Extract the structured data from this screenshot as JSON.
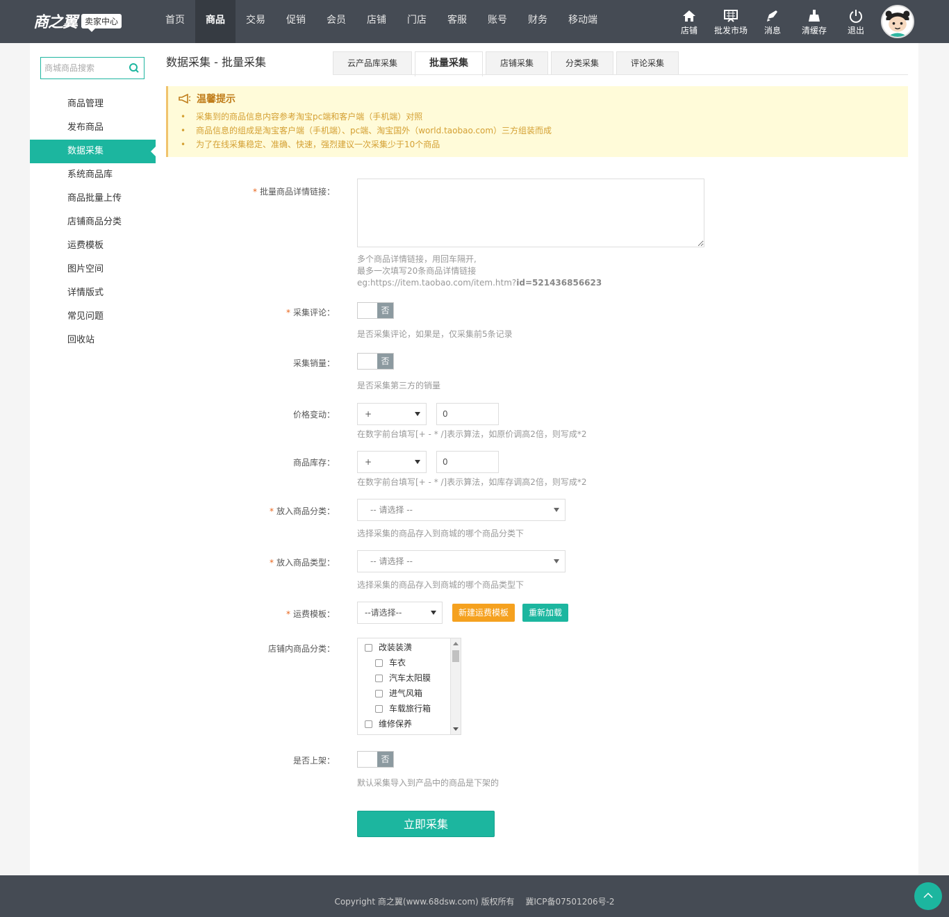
{
  "header": {
    "logo_text": "商之翼",
    "logo_badge": "卖家中心",
    "nav": [
      "首页",
      "商品",
      "交易",
      "促销",
      "会员",
      "店铺",
      "门店",
      "客服",
      "账号",
      "财务",
      "移动端"
    ],
    "active_nav": "商品",
    "tools": [
      {
        "label": "店铺",
        "icon": "home-icon"
      },
      {
        "label": "批发市场",
        "icon": "market-icon"
      },
      {
        "label": "消息",
        "icon": "bell-icon"
      },
      {
        "label": "清缓存",
        "icon": "broom-icon"
      },
      {
        "label": "退出",
        "icon": "power-icon"
      }
    ]
  },
  "sidebar": {
    "search_placeholder": "商城商品搜索",
    "items": [
      "商品管理",
      "发布商品",
      "数据采集",
      "系统商品库",
      "商品批量上传",
      "店铺商品分类",
      "运费模板",
      "图片空间",
      "详情版式",
      "常见问题",
      "回收站"
    ],
    "active": "数据采集"
  },
  "main": {
    "title": "数据采集 - 批量采集",
    "tabs": [
      "云产品库采集",
      "批量采集",
      "店铺采集",
      "分类采集",
      "评论采集"
    ],
    "active_tab": "批量采集"
  },
  "tip": {
    "title": "温馨提示",
    "items": [
      "采集到的商品信息内容参考淘宝pc端和客户端（手机端）对照",
      "商品信息的组成是淘宝客户端（手机端）、pc端、淘宝国外（world.taobao.com）三方组装而成",
      "为了在线采集稳定、准确、快速，强烈建议一次采集少于10个商品"
    ]
  },
  "form": {
    "links": {
      "label": "批量商品详情链接：",
      "value": "",
      "hint1": "多个商品详情链接，用回车隔开,",
      "hint2": "最多一次填写20条商品详情链接",
      "hint3_prefix": "eg:https://item.taobao.com/item.htm?",
      "hint3_bold": "id=521436856623"
    },
    "comment": {
      "label": "采集评论：",
      "switch": "否",
      "hint": "是否采集评论，如果是，仅采集前5条记录"
    },
    "sales": {
      "label": "采集销量：",
      "switch": "否",
      "hint": "是否采集第三方的销量"
    },
    "price": {
      "label": "价格变动：",
      "op": "+",
      "value": "0",
      "hint": "在数字前台填写[+ - * /]表示算法，如原价调高2倍，则写成*2"
    },
    "stock": {
      "label": "商品库存：",
      "op": "+",
      "value": "0",
      "hint": "在数字前台填写[+ - * /]表示算法，如库存调高2倍，则写成*2"
    },
    "category": {
      "label": "放入商品分类：",
      "placeholder": "-- 请选择 --",
      "hint": "选择采集的商品存入到商城的哪个商品分类下"
    },
    "type": {
      "label": "放入商品类型：",
      "placeholder": "-- 请选择 --",
      "hint": "选择采集的商品存入到商城的哪个商品类型下"
    },
    "freight": {
      "label": "运费模板：",
      "placeholder": "--请选择--",
      "new_btn": "新建运费模板",
      "reload_btn": "重新加载"
    },
    "shop_category": {
      "label": "店铺内商品分类：",
      "items": [
        {
          "name": "改装装潢",
          "level": 0
        },
        {
          "name": "车衣",
          "level": 1
        },
        {
          "name": "汽车太阳膜",
          "level": 1
        },
        {
          "name": "进气风箱",
          "level": 1
        },
        {
          "name": "车载旅行箱",
          "level": 1
        },
        {
          "name": "维修保养",
          "level": 0
        }
      ]
    },
    "onsale": {
      "label": "是否上架：",
      "switch": "否",
      "hint": "默认采集导入到产品中的商品是下架的"
    },
    "submit": "立即采集"
  },
  "footer": {
    "copyright": "Copyright 商之翼(www.68dsw.com) 版权所有",
    "icp": "冀ICP备07501206号-2"
  },
  "colors": {
    "accent": "#1cb69f",
    "header": "#454b54",
    "orange": "#f5a11f"
  }
}
